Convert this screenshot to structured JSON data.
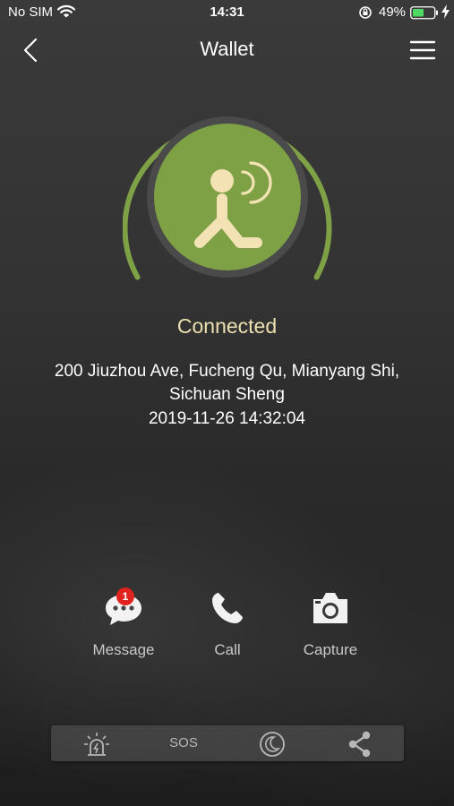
{
  "status_bar": {
    "carrier": "No SIM",
    "time": "14:31",
    "battery": "49%",
    "icons": [
      "wifi-icon",
      "orientation-lock-icon",
      "battery-icon",
      "charging-bolt-icon"
    ]
  },
  "nav": {
    "title": "Wallet",
    "back_icon": "chevron-left-icon",
    "menu_icon": "hamburger-menu-icon"
  },
  "device": {
    "status": "Connected",
    "status_color": "#ece0b0",
    "circle_color": "#7ea145",
    "icon": "person-signal-icon",
    "address": "200 Jiuzhou Ave, Fucheng Qu, Mianyang Shi, Sichuan Sheng",
    "timestamp": "2019-11-26 14:32:04"
  },
  "actions": [
    {
      "label": "Message",
      "icon": "chat-bubble-icon",
      "badge": "1"
    },
    {
      "label": "Call",
      "icon": "phone-icon"
    },
    {
      "label": "Capture",
      "icon": "camera-icon"
    }
  ],
  "toolbar": {
    "alarm_icon": "alarm-icon",
    "sos_label": "SOS",
    "sleep_icon": "moon-icon",
    "share_icon": "share-icon"
  }
}
